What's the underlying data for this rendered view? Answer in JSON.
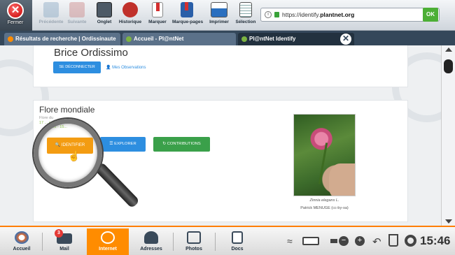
{
  "toolbar": {
    "close_label": "Fermer",
    "buttons": [
      {
        "label": "Précédente"
      },
      {
        "label": "Suivante"
      },
      {
        "label": "Onglet"
      },
      {
        "label": "Historique"
      },
      {
        "label": "Marquer"
      },
      {
        "label": "Marque-pages"
      },
      {
        "label": "Imprimer"
      },
      {
        "label": "Sélection"
      }
    ],
    "url_prefix": "https://identify.",
    "url_domain": "plantnet.org",
    "ok_label": "OK"
  },
  "tabs": [
    {
      "label": "Résultats de recherche | Ordissinaute"
    },
    {
      "label": "Accueil - Pl@ntNet"
    },
    {
      "label": "Pl@ntNet Identify"
    }
  ],
  "page": {
    "user_name": "Brice Ordissimo",
    "logout_label": "SE DÉCONNECTER",
    "observations_label": "Mes Observations",
    "flora_title": "Flore mondiale",
    "flora_subtitle": "Flore du",
    "flora_stats": "17 ... ces - 15... ...ages",
    "lens_stats": "17... ...ces - 15...",
    "identify_label": "IDENTIFIER",
    "explore_label": "EXPLORER",
    "contributions_label": "CONTRIBUTIONS",
    "photo_caption": "Zinnia elegans L.",
    "photo_credit": "Patrick MENUGE (cc-by-sa)"
  },
  "taskbar": {
    "items": [
      {
        "label": "Accueil"
      },
      {
        "label": "Mail"
      },
      {
        "label": "Internet"
      },
      {
        "label": "Adresses"
      },
      {
        "label": "Photos"
      },
      {
        "label": "Docs"
      }
    ],
    "mail_badge": "3",
    "time": "15:46"
  },
  "colors": {
    "accent": "#ff8c00",
    "blue_button": "#2d8ee0",
    "green_button": "#3aa04a",
    "identify_button": "#f39c12",
    "tab_bar": "#34475a"
  }
}
